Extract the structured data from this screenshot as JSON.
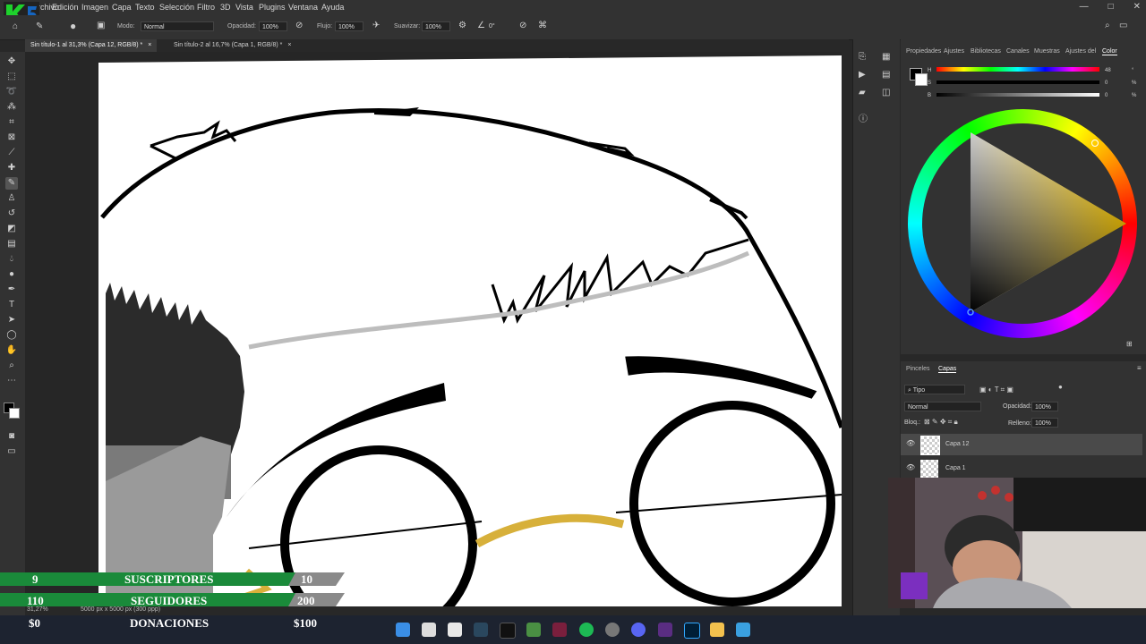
{
  "colors": {
    "accent": "#31a8ff",
    "overlay_green": "#1a8a3a",
    "overlay_gray": "#8a8a8a",
    "gold": "#d7b03a"
  },
  "menubar": {
    "items": [
      "Archivo",
      "Edición",
      "Imagen",
      "Capa",
      "Texto",
      "Selección",
      "Filtro",
      "3D",
      "Vista",
      "Plugins",
      "Ventana",
      "Ayuda"
    ]
  },
  "optbar": {
    "mode_label": "Modo:",
    "mode_value": "Normal",
    "opacity_label": "Opacidad:",
    "opacity_value": "100%",
    "flow_label": "Flujo:",
    "flow_value": "100%",
    "smooth_label": "Suavizar:",
    "smooth_value": "100%",
    "angle_value": "0°"
  },
  "tabs": [
    {
      "label": "Sin título-1 al 31,3% (Capa 12, RGB/8) *",
      "close": "×"
    },
    {
      "label": "Sin título-2 al 16,7% (Capa 1, RGB/8) *",
      "close": "×"
    }
  ],
  "status": {
    "zoom": "31,27%",
    "doc": "5000 px x 5000 px (300 ppp)"
  },
  "colorpanel": {
    "tabs": [
      "Propiedades",
      "Ajustes",
      "Bibliotecas",
      "Canales",
      "Muestras",
      "Ajustes del",
      "Color"
    ],
    "sliders": [
      {
        "label": "H",
        "value": "48",
        "unit": "°"
      },
      {
        "label": "S",
        "value": "0",
        "unit": "%"
      },
      {
        "label": "B",
        "value": "0",
        "unit": "%"
      }
    ]
  },
  "layerspanel": {
    "tabs": [
      "Pinceles",
      "Capas"
    ],
    "filter_label": "Tipo",
    "blend_value": "Normal",
    "opacity_label": "Opacidad:",
    "opacity_value": "100%",
    "lock_label": "Bloq.:",
    "fill_label": "Relleno:",
    "fill_value": "100%",
    "layers": [
      {
        "name": "Capa 12"
      },
      {
        "name": "Capa 1"
      }
    ]
  },
  "overlay": {
    "row1": {
      "left": "9",
      "label": "SUSCRIPTORES",
      "right": "10"
    },
    "row2": {
      "left": "110",
      "label": "SEGUIDORES",
      "right": "200"
    },
    "row3": {
      "left": "$0",
      "label": "DONACIONES",
      "right": "$100"
    }
  },
  "taskbar": {
    "icons": [
      "windows-icon",
      "search-icon",
      "store-icon",
      "steam-icon",
      "tiktok-icon",
      "app-icon",
      "app-icon",
      "spotify-icon",
      "app-icon",
      "discord-icon",
      "app-icon",
      "photoshop-icon",
      "folder-icon",
      "app-icon"
    ]
  }
}
